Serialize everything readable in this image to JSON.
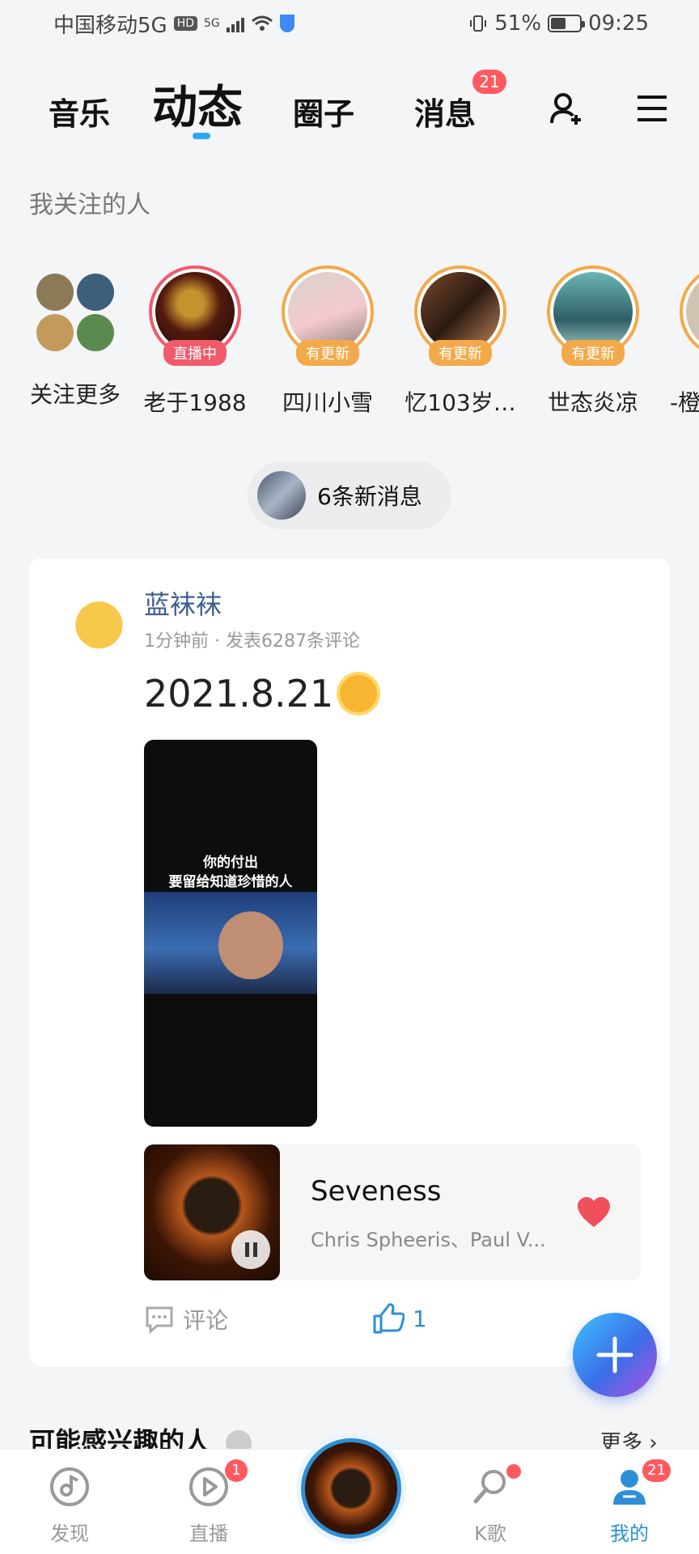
{
  "status": {
    "carrier": "中国移动5G",
    "hd": "HD",
    "network": "5G",
    "battery": "51%",
    "time": "09:25"
  },
  "nav": {
    "tabs": [
      "音乐",
      "动态",
      "圈子",
      "消息"
    ],
    "active_tab": "动态",
    "message_badge": "21",
    "icons": [
      "add-friend-icon",
      "menu-icon"
    ]
  },
  "following": {
    "title": "我关注的人",
    "items": [
      {
        "name": "关注更多",
        "badge": ""
      },
      {
        "name": "老于1988",
        "badge": "直播中"
      },
      {
        "name": "四川小雪",
        "badge": "有更新"
      },
      {
        "name": "忆103岁…",
        "badge": "有更新"
      },
      {
        "name": "世态炎凉",
        "badge": "有更新"
      },
      {
        "name": "-橙",
        "badge": ""
      }
    ]
  },
  "new_messages": {
    "label": "6条新消息"
  },
  "post": {
    "user": "蓝袜袜",
    "meta": "1分钟前 · 发表6287条评论",
    "text": "2021.8.21",
    "image_caption_line1": "你的付出",
    "image_caption_line2": "要留给知道珍惜的人",
    "song": {
      "title": "Seveness",
      "artist": "Chris Spheeris、Paul V..."
    },
    "comment_label": "评论",
    "like_count": "1"
  },
  "suggest": {
    "title": "可能感兴趣的人",
    "more": "更多"
  },
  "bottom_nav": {
    "items": [
      {
        "label": "发现",
        "badge": ""
      },
      {
        "label": "直播",
        "badge": "1"
      },
      {
        "label": "K歌",
        "badge": ""
      },
      {
        "label": "我的",
        "badge": "21"
      }
    ]
  },
  "colors": {
    "accent": "#2e8fd8",
    "badge": "#ff5a5f",
    "update_ring": "#f3a94a",
    "live_ring": "#f05a6b",
    "username": "#3e5e8e"
  }
}
